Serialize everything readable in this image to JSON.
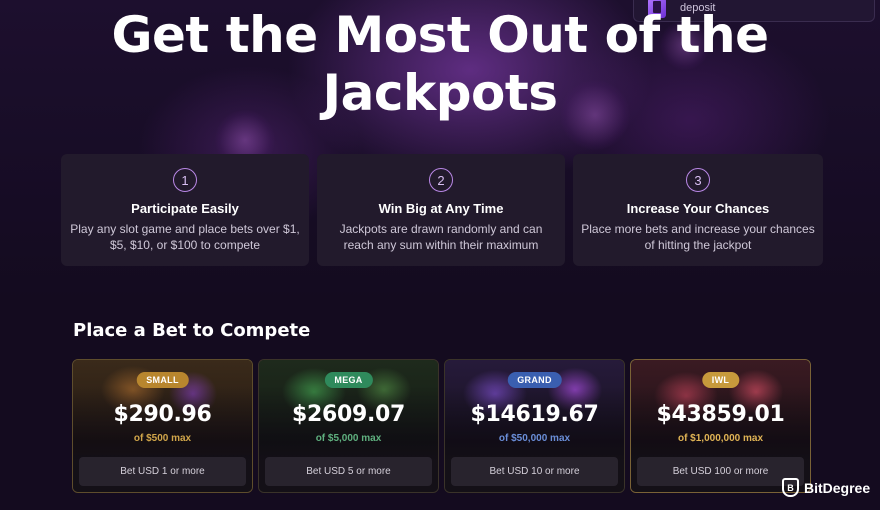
{
  "notification": {
    "text": "deposit",
    "icon": "gift-icon"
  },
  "hero": {
    "title": "Get the Most Out of the Jackpots"
  },
  "steps": [
    {
      "number": "1",
      "title": "Participate Easily",
      "description": "Play any slot game and place bets over $1, $5, $10, or $100 to compete"
    },
    {
      "number": "2",
      "title": "Win Big at Any Time",
      "description": "Jackpots are drawn randomly and can reach any sum within their maximum"
    },
    {
      "number": "3",
      "title": "Increase Your Chances",
      "description": "Place more bets and increase your chances of hitting the jackpot"
    }
  ],
  "section": {
    "title": "Place a Bet to Compete"
  },
  "jackpots": [
    {
      "badge": "SMALL",
      "amount": "$290.96",
      "max": "of $500 max",
      "button": "Bet USD 1 or more",
      "badge_color": "#b8862e",
      "max_color": "#d1a64a"
    },
    {
      "badge": "MEGA",
      "amount": "$2609.07",
      "max": "of $5,000 max",
      "button": "Bet USD 5 or more",
      "badge_color": "#2f8a5c",
      "max_color": "#5fb07f"
    },
    {
      "badge": "GRAND",
      "amount": "$14619.67",
      "max": "of $50,000 max",
      "button": "Bet USD 10 or more",
      "badge_color": "#3a5fb0",
      "max_color": "#6a8ed8"
    },
    {
      "badge": "IWL",
      "amount": "$43859.01",
      "max": "of $1,000,000 max",
      "button": "Bet USD 100 or more",
      "badge_color": "#c79a3c",
      "max_color": "#e0b455"
    }
  ],
  "watermark": {
    "text": "BitDegree",
    "icon_letter": "B"
  }
}
